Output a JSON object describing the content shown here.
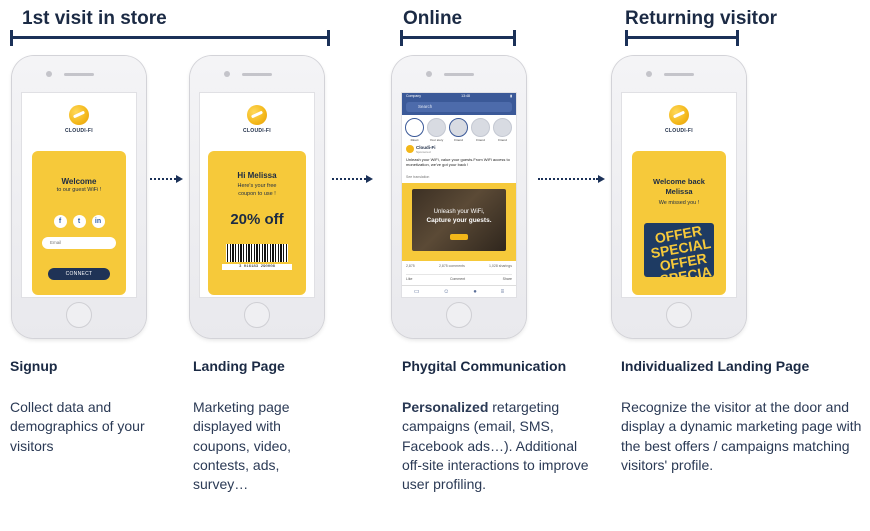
{
  "sections": {
    "store": "1st visit in store",
    "online": "Online",
    "returning": "Returning visitor"
  },
  "brand": "CLOUDI-FI",
  "screen1": {
    "welcome": "Welcome",
    "subtitle": "to our guest WiFi !",
    "social_icons": [
      "facebook-icon",
      "twitter-icon",
      "linkedin-icon"
    ],
    "social_glyphs": [
      "f",
      "t",
      "in"
    ],
    "email_placeholder": "Email",
    "connect_label": "CONNECT"
  },
  "screen2": {
    "greeting": "Hi Melissa",
    "line1": "Here's your free",
    "line2": "coupon to use !",
    "discount": "20% off",
    "barcode_number": "3 016183 290008"
  },
  "screen3": {
    "status_left": "Company",
    "status_time": "13:48",
    "search_placeholder": "Search",
    "stories": [
      "Direct",
      "Your story",
      "Friend",
      "Friend",
      "Friend"
    ],
    "page_name": "Cloudi-Fi",
    "post_meta": "Sponsored",
    "post_text": "Unleash your WiFi, value your guests.From WiFi access to monetization, we've got your back !",
    "see_translation": "See translation",
    "ad_line1": "Unleash your WiFi,",
    "ad_line2": "Capture your guests.",
    "reactions": "2,875",
    "comments": "2,875 comments",
    "shares": "1,028 sharings",
    "actions": [
      "Like",
      "Comment",
      "Share"
    ]
  },
  "screen4": {
    "line1": "Welcome back",
    "line2": "Melissa",
    "line3": "We missed you !",
    "offer_words": [
      "OFFER",
      "SPECIAL",
      "OFFER",
      "SPECIA"
    ]
  },
  "captions": [
    {
      "title": "Signup",
      "text": "Collect data and demographics of your visitors"
    },
    {
      "title": "Landing Page",
      "text": "Marketing page displayed with coupons, video, contests, ads, survey…"
    },
    {
      "title": "Phygital Communication",
      "bold": "Personalized",
      "text": " retargeting campaigns (email, SMS, Facebook ads…). Additional off-site interactions to improve user profiling."
    },
    {
      "title": "Individualized Landing Page",
      "text": "Recognize the visitor at the door and display a dynamic marketing page with the best offers / campaigns matching visitors' profile."
    }
  ],
  "colors": {
    "accent_yellow": "#f6c93a",
    "navy": "#1b3158",
    "facebook_blue": "#3b5998"
  }
}
